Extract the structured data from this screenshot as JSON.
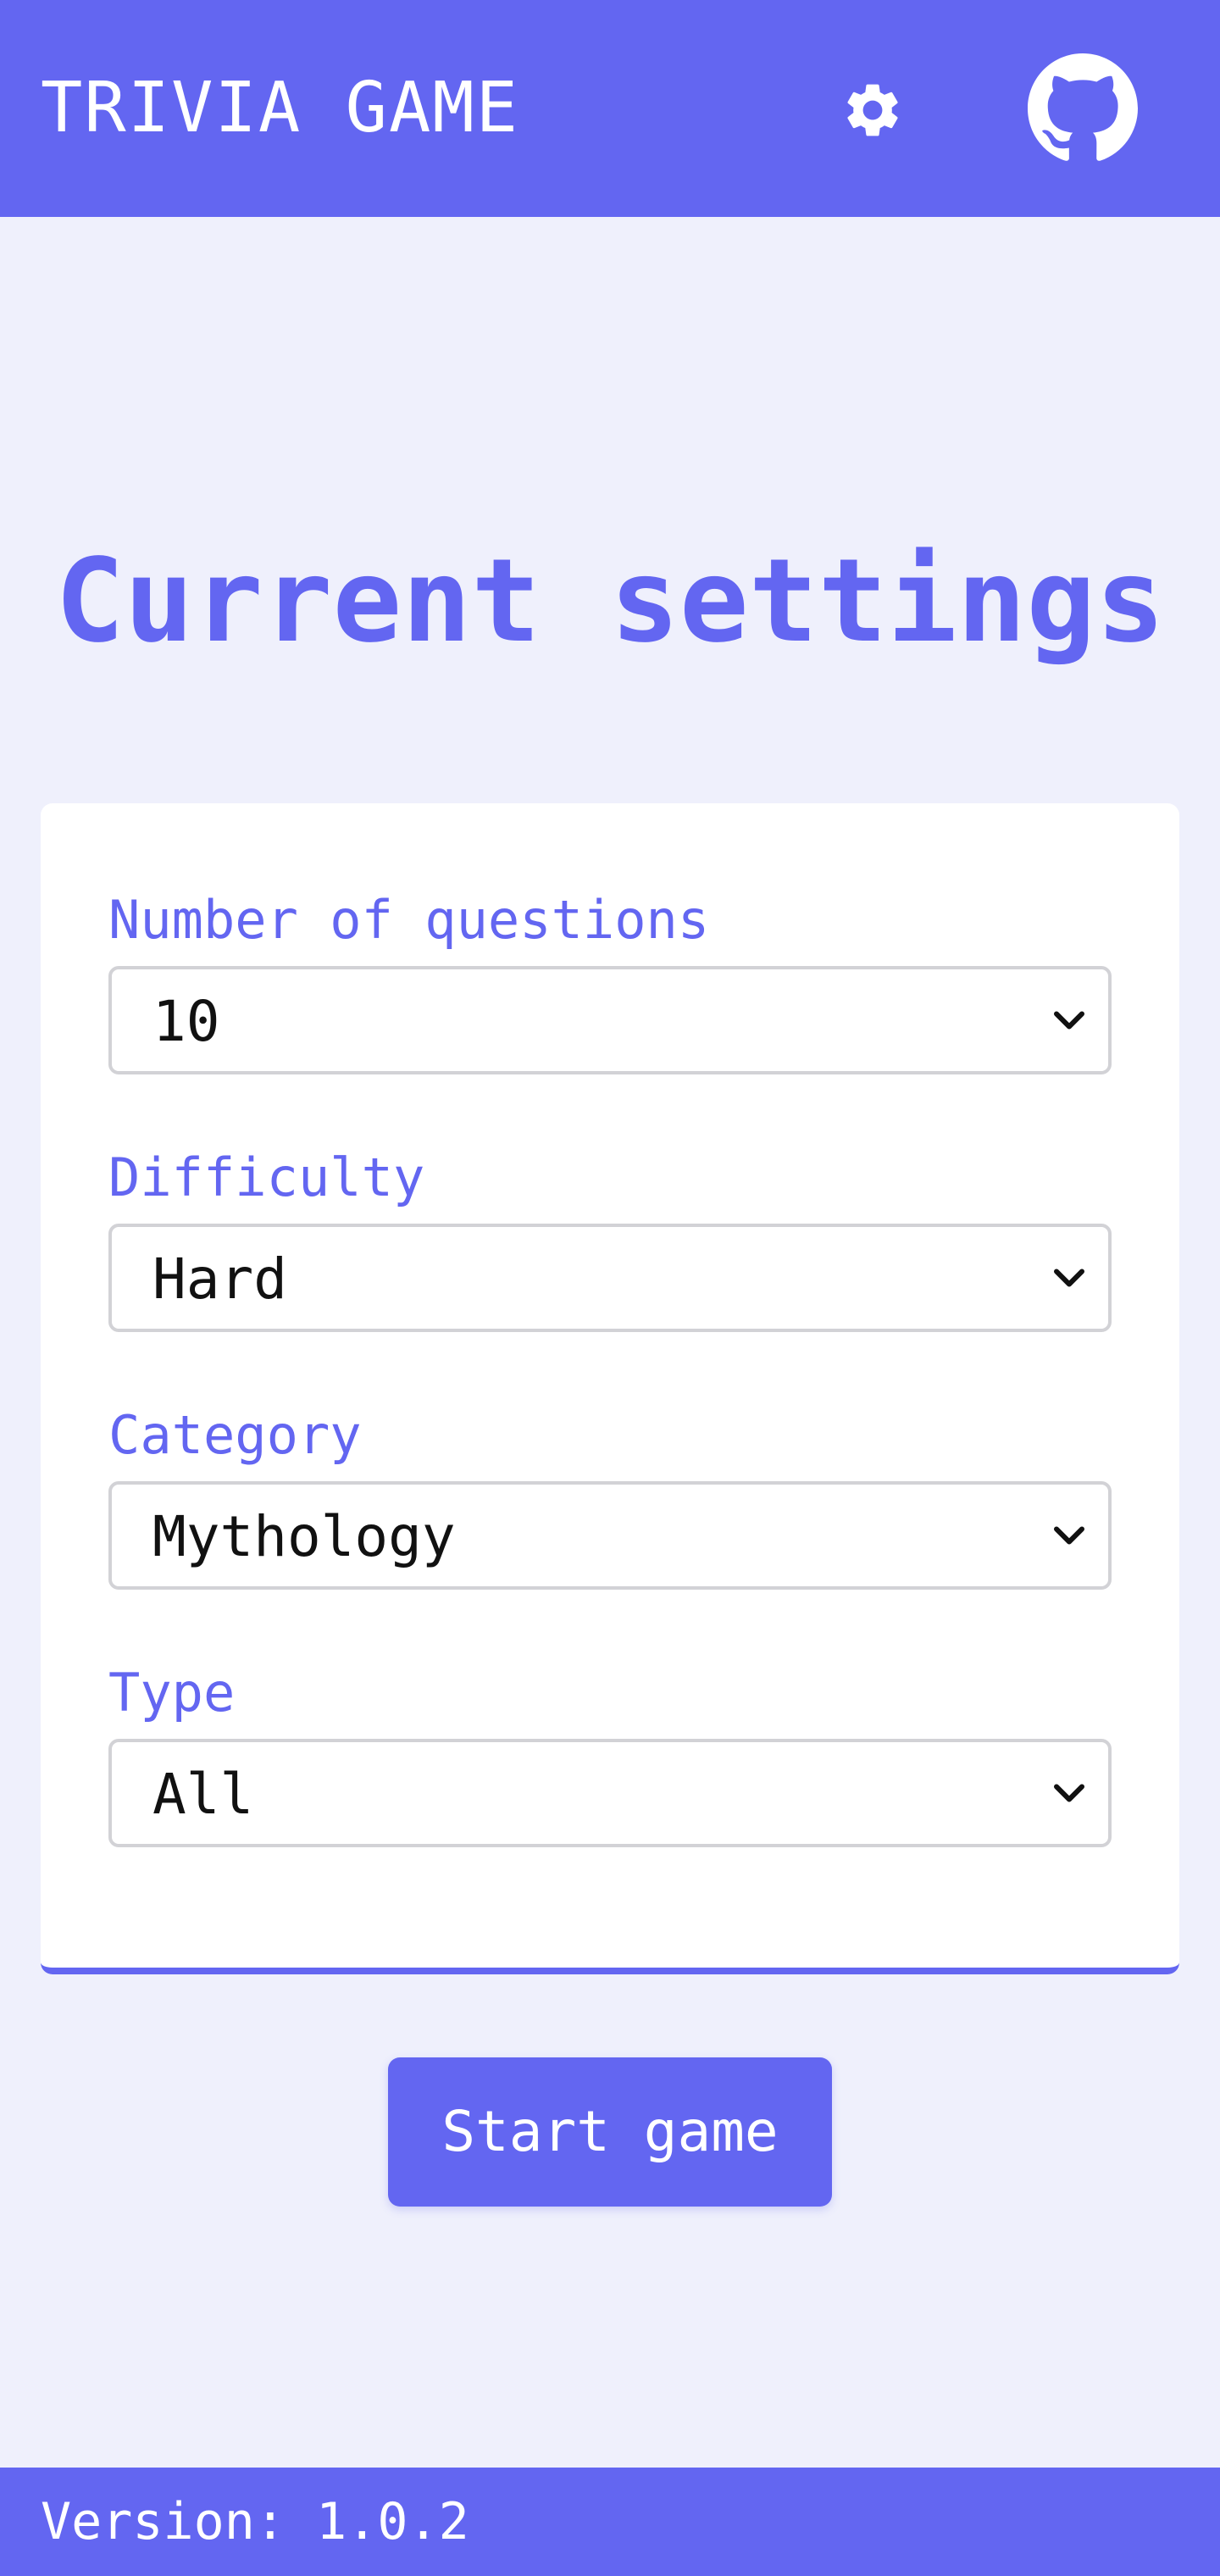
{
  "header": {
    "title": "TRIVIA GAME",
    "settings_icon": "gear-icon",
    "github_icon": "github-icon"
  },
  "main": {
    "title": "Current settings",
    "fields": [
      {
        "label": "Number of questions",
        "value": "10"
      },
      {
        "label": "Difficulty",
        "value": "Hard"
      },
      {
        "label": "Category",
        "value": "Mythology"
      },
      {
        "label": "Type",
        "value": "All"
      }
    ],
    "start_label": "Start game"
  },
  "footer": {
    "version": "Version: 1.0.2"
  },
  "colors": {
    "accent": "#6366f1",
    "background": "#eff0fc",
    "card": "#ffffff"
  }
}
